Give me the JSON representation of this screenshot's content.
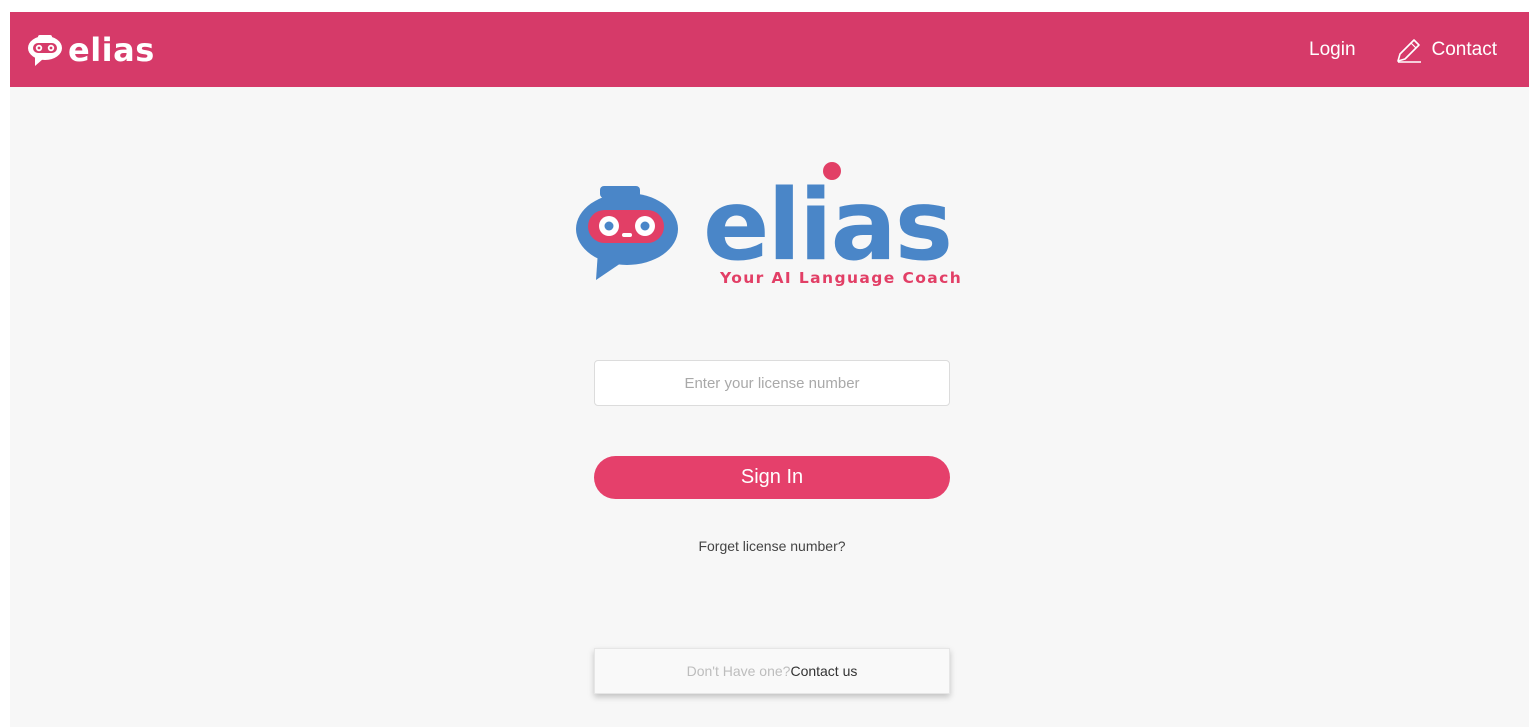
{
  "colors": {
    "navbar_bg": "#d63a69",
    "primary_button": "#e5406b",
    "logo_blue": "#4a86c8",
    "logo_pink": "#e23f66",
    "page_bg": "#f7f7f7"
  },
  "navbar": {
    "brand_text": "elias",
    "brand_icon": "robot-chat-icon",
    "links": {
      "login": "Login",
      "contact": "Contact",
      "contact_icon": "pen-icon"
    }
  },
  "hero": {
    "logo_text": "elias",
    "tagline": "Your AI Language Coach",
    "logo_icon": "robot-chat-icon"
  },
  "login_form": {
    "license_placeholder": "Enter your license number",
    "license_value": "",
    "sign_in_label": "Sign In",
    "forgot_label": "Forget license number?"
  },
  "contact_prompt": {
    "question": "Don't Have one?",
    "link_label": "Contact us"
  }
}
